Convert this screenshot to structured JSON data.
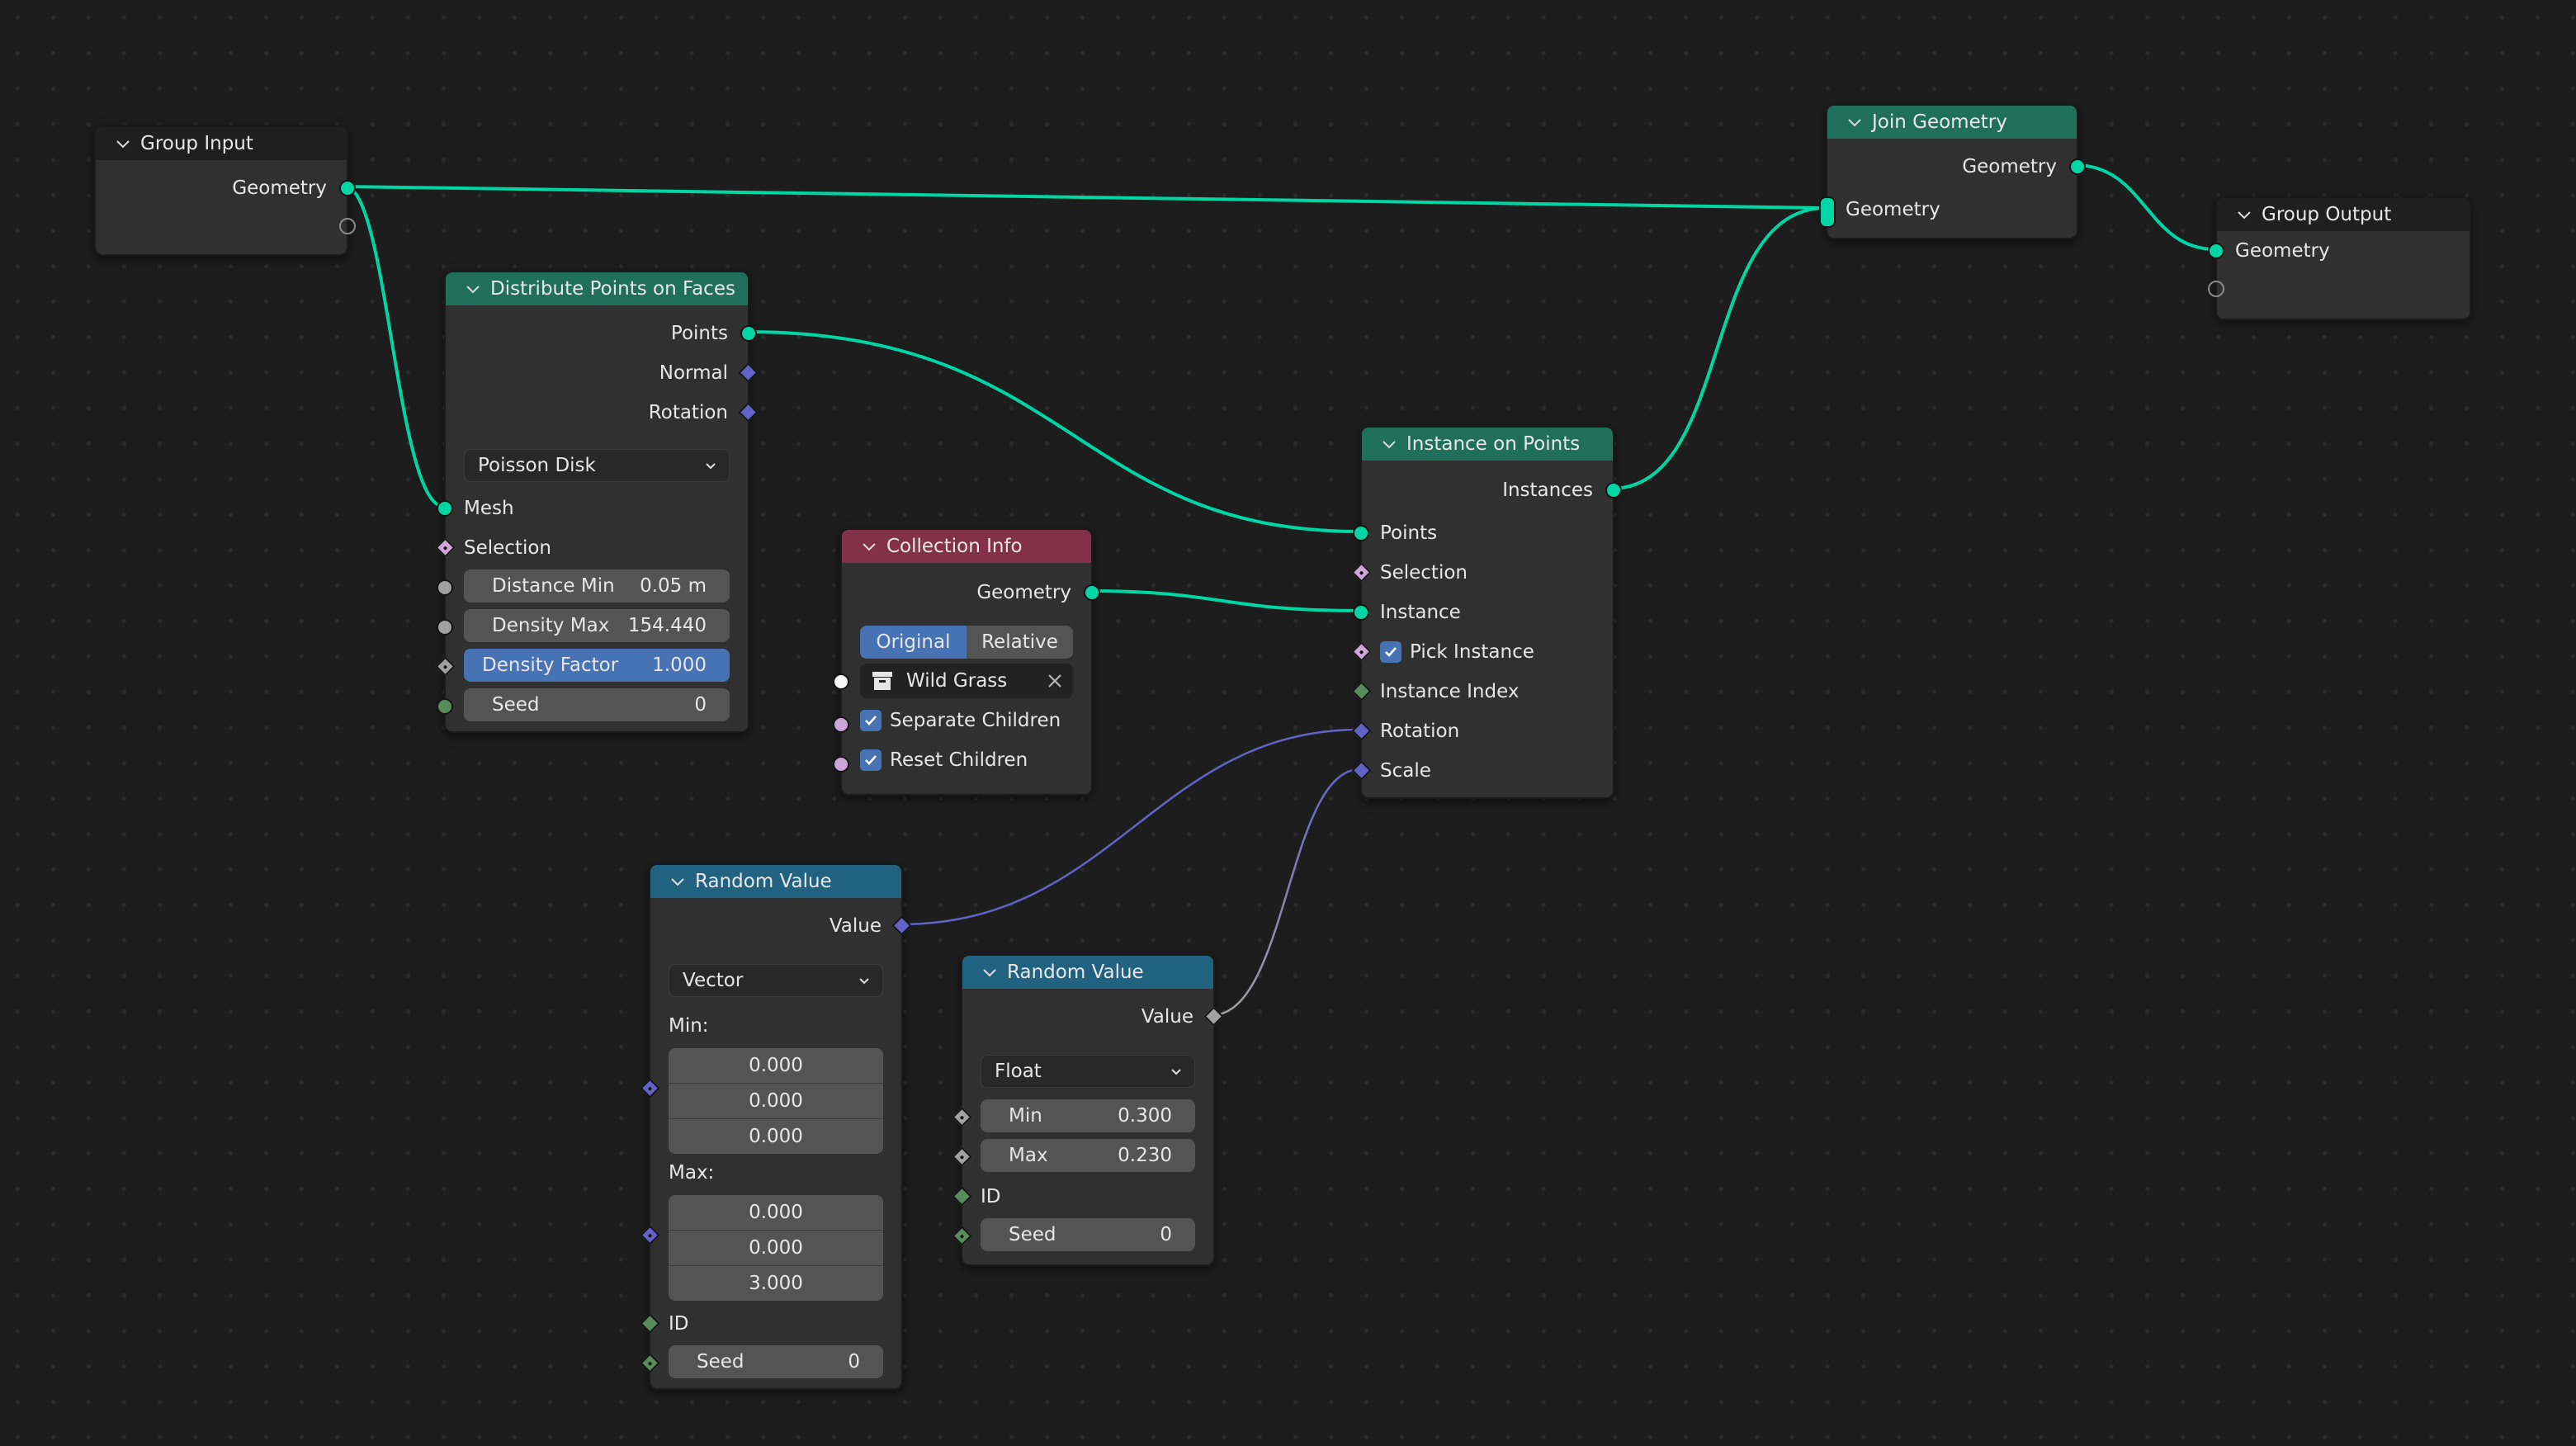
{
  "editor": "Geometry Node Editor",
  "colors": {
    "geometry_socket": "#00d6a3",
    "vector_socket": "#6363c7",
    "float_socket": "#a1a1a1",
    "integer_socket": "#598c5c",
    "boolean_socket": "#cca6d6",
    "collection_socket": "#f5f5f5",
    "header_geometry": "#1f6f5a",
    "header_input": "#83314a",
    "header_utility": "#226281",
    "header_group": "#1f1f1f",
    "active_field": "#4772b3"
  },
  "nodes": {
    "group_input": {
      "title": "Group Input",
      "outputs": [
        "Geometry"
      ]
    },
    "distribute": {
      "title": "Distribute Points on Faces",
      "outputs": [
        "Points",
        "Normal",
        "Rotation"
      ],
      "mode": "Poisson Disk",
      "inputs": [
        "Mesh",
        "Selection"
      ],
      "fields": [
        {
          "label": "Distance Min",
          "value": "0.05 m"
        },
        {
          "label": "Density Max",
          "value": "154.440"
        },
        {
          "label": "Density Factor",
          "value": "1.000"
        },
        {
          "label": "Seed",
          "value": "0"
        }
      ]
    },
    "collection_info": {
      "title": "Collection Info",
      "outputs": [
        "Geometry"
      ],
      "transform_space": [
        "Original",
        "Relative"
      ],
      "transform_space_selected": "Original",
      "collection": "Wild Grass",
      "separate_children_label": "Separate Children",
      "separate_children": true,
      "reset_children_label": "Reset Children",
      "reset_children": true
    },
    "instance_on_points": {
      "title": "Instance on Points",
      "outputs": [
        "Instances"
      ],
      "inputs": [
        "Points",
        "Selection",
        "Instance",
        "Pick Instance",
        "Instance Index",
        "Rotation",
        "Scale"
      ],
      "pick_instance": true
    },
    "join_geometry": {
      "title": "Join Geometry",
      "outputs": [
        "Geometry"
      ],
      "inputs": [
        "Geometry"
      ]
    },
    "group_output": {
      "title": "Group Output",
      "inputs": [
        "Geometry"
      ]
    },
    "random_vector": {
      "title": "Random Value",
      "outputs": [
        "Value"
      ],
      "data_type": "Vector",
      "min_label": "Min:",
      "min": [
        "0.000",
        "0.000",
        "0.000"
      ],
      "max_label": "Max:",
      "max": [
        "0.000",
        "0.000",
        "3.000"
      ],
      "id_label": "ID",
      "seed_label": "Seed",
      "seed": "0"
    },
    "random_float": {
      "title": "Random Value",
      "outputs": [
        "Value"
      ],
      "data_type": "Float",
      "min_label": "Min",
      "min": "0.300",
      "max_label": "Max",
      "max": "0.230",
      "id_label": "ID",
      "seed_label": "Seed",
      "seed": "0"
    }
  },
  "links": [
    {
      "from": "Group Input.Geometry",
      "to": "Distribute Points on Faces.Mesh"
    },
    {
      "from": "Group Input.Geometry",
      "to": "Join Geometry.Geometry"
    },
    {
      "from": "Distribute Points on Faces.Points",
      "to": "Instance on Points.Points"
    },
    {
      "from": "Collection Info.Geometry",
      "to": "Instance on Points.Instance"
    },
    {
      "from": "Instance on Points.Instances",
      "to": "Join Geometry.Geometry"
    },
    {
      "from": "Join Geometry.Geometry",
      "to": "Group Output.Geometry"
    },
    {
      "from": "Random Value (Vector).Value",
      "to": "Instance on Points.Rotation"
    },
    {
      "from": "Random Value (Float).Value",
      "to": "Instance on Points.Scale"
    }
  ]
}
